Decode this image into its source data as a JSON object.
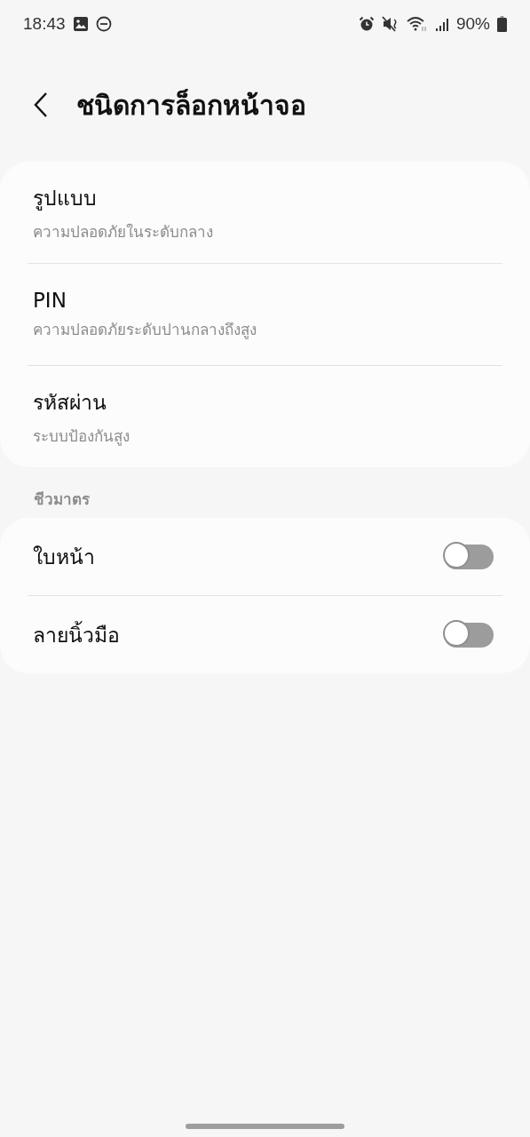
{
  "status_bar": {
    "time": "18:43",
    "battery": "90%"
  },
  "header": {
    "title": "ชนิดการล็อกหน้าจอ"
  },
  "lock_types": [
    {
      "title": "รูปแบบ",
      "subtitle": "ความปลอดภัยในระดับกลาง"
    },
    {
      "title": "PIN",
      "subtitle": "ความปลอดภัยระดับปานกลางถึงสูง"
    },
    {
      "title": "รหัสผ่าน",
      "subtitle": "ระบบป้องกันสูง"
    }
  ],
  "biometrics": {
    "heading": "ชีวมาตร",
    "items": [
      {
        "label": "ใบหน้า",
        "on": false
      },
      {
        "label": "ลายนิ้วมือ",
        "on": false
      }
    ]
  }
}
